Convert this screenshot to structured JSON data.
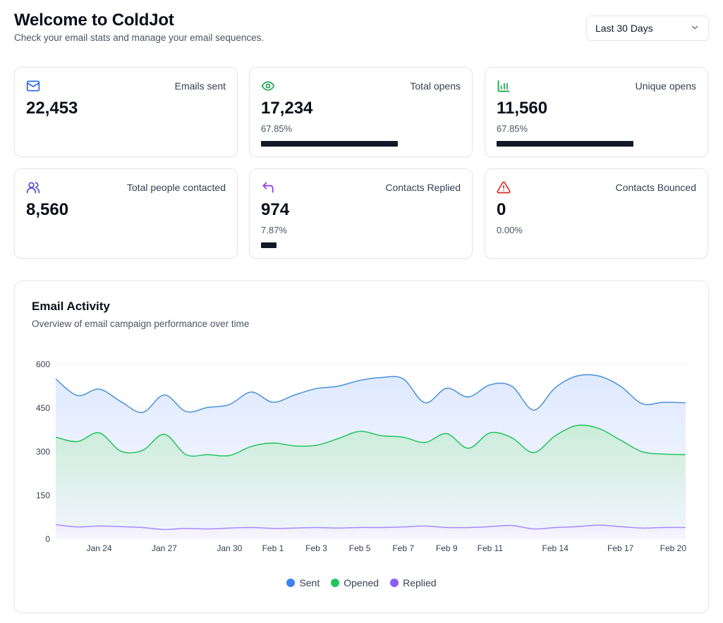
{
  "header": {
    "title": "Welcome to ColdJot",
    "subtitle": "Check your email stats and manage your email sequences."
  },
  "range_select": {
    "value": "Last 30 Days",
    "icon": "chevron-down-icon"
  },
  "stats": [
    {
      "label": "Emails sent",
      "value": "22,453",
      "icon": "mail-icon",
      "color": "#2563eb"
    },
    {
      "label": "Total opens",
      "value": "17,234",
      "percent_text": "67.85%",
      "progress": 0.68,
      "icon": "eye-icon",
      "color": "#16a34a"
    },
    {
      "label": "Unique opens",
      "value": "11,560",
      "percent_text": "67.85%",
      "progress": 0.68,
      "icon": "bar-chart-icon",
      "color": "#16a34a"
    },
    {
      "label": "Total people contacted",
      "value": "8,560",
      "icon": "users-icon",
      "color": "#4f46e5"
    },
    {
      "label": "Contacts Replied",
      "value": "974",
      "percent_text": "7.87%",
      "progress": 0.0787,
      "icon": "reply-icon",
      "color": "#9333ea"
    },
    {
      "label": "Contacts Bounced",
      "value": "0",
      "percent_text": "0.00%",
      "progress": 0,
      "icon": "alert-triangle-icon",
      "color": "#dc2626"
    }
  ],
  "activity": {
    "title": "Email Activity",
    "subtitle": "Overview of email campaign performance over time"
  },
  "chart_data": {
    "type": "area",
    "x": [
      "Jan 22",
      "Jan 23",
      "Jan 24",
      "Jan 25",
      "Jan 26",
      "Jan 27",
      "Jan 28",
      "Jan 29",
      "Jan 30",
      "Jan 31",
      "Feb 1",
      "Feb 2",
      "Feb 3",
      "Feb 4",
      "Feb 5",
      "Feb 6",
      "Feb 7",
      "Feb 8",
      "Feb 9",
      "Feb 10",
      "Feb 11",
      "Feb 12",
      "Feb 13",
      "Feb 14",
      "Feb 15",
      "Feb 16",
      "Feb 17",
      "Feb 18",
      "Feb 19",
      "Feb 20"
    ],
    "x_tick_labels": [
      "Jan 24",
      "Jan 27",
      "Jan 30",
      "Feb 1",
      "Feb 3",
      "Feb 5",
      "Feb 7",
      "Feb 9",
      "Feb 11",
      "Feb 14",
      "Feb 17",
      "Feb 20"
    ],
    "series": [
      {
        "name": "Sent",
        "color": "#4a90d9",
        "legend_color": "#3b82f6",
        "values": [
          550,
          493,
          515,
          472,
          435,
          495,
          438,
          452,
          462,
          505,
          470,
          495,
          517,
          525,
          545,
          555,
          550,
          468,
          518,
          488,
          530,
          525,
          443,
          520,
          560,
          560,
          525,
          465,
          470,
          468
        ]
      },
      {
        "name": "Opened",
        "color": "#22c55e",
        "legend_color": "#22c55e",
        "values": [
          350,
          335,
          365,
          302,
          305,
          360,
          290,
          290,
          287,
          318,
          330,
          320,
          322,
          345,
          370,
          355,
          350,
          332,
          362,
          312,
          365,
          348,
          297,
          355,
          390,
          380,
          340,
          300,
          292,
          290
        ]
      },
      {
        "name": "Replied",
        "color": "#a78bfa",
        "legend_color": "#8b5cf6",
        "values": [
          50,
          42,
          45,
          43,
          40,
          33,
          37,
          35,
          38,
          40,
          37,
          38,
          40,
          38,
          40,
          40,
          42,
          45,
          40,
          40,
          43,
          47,
          35,
          40,
          43,
          48,
          43,
          38,
          40,
          40
        ]
      }
    ],
    "yticks": [
      0,
      150,
      300,
      450,
      600
    ],
    "ylim": [
      0,
      600
    ],
    "grid": "horizontal-dashed",
    "legend": "bottom-center"
  }
}
